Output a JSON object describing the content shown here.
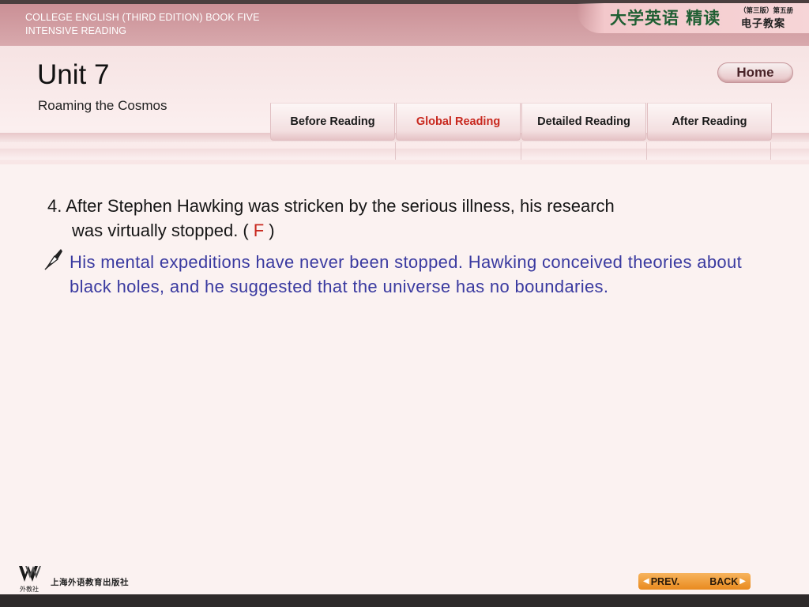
{
  "header": {
    "line1": "COLLEGE ENGLISH (THIRD EDITION) BOOK FIVE",
    "line2": "INTENSIVE READING",
    "brand_main": "大学英语 精读",
    "brand_edition": "（第三版）第五册",
    "brand_sub": "电子教案"
  },
  "title": {
    "unit": "Unit 7",
    "subtitle": "Roaming the Cosmos"
  },
  "home_label": "Home",
  "tabs": [
    {
      "label": "Before Reading",
      "active": false
    },
    {
      "label": "Global Reading",
      "active": true
    },
    {
      "label": "Detailed Reading",
      "active": false
    },
    {
      "label": "After Reading",
      "active": false
    }
  ],
  "question": {
    "line1": "4. After Stephen Hawking was stricken by the serious illness, his research",
    "line2_before": "was virtually stopped. (",
    "answer": "F",
    "line2_after": ")"
  },
  "explanation": "His mental expeditions have never been stopped. Hawking conceived theories about black holes, and he suggested that the universe has no boundaries.",
  "footer": {
    "publisher_mark": "外教社",
    "publisher_name": "上海外语教育出版社",
    "prev_label": "PREV.",
    "back_label": "BACK"
  },
  "colors": {
    "accent_red": "#c8281e",
    "explanation_blue": "#3a3aa0",
    "header_pink": "#c98d93",
    "button_orange": "#e98a1e"
  }
}
